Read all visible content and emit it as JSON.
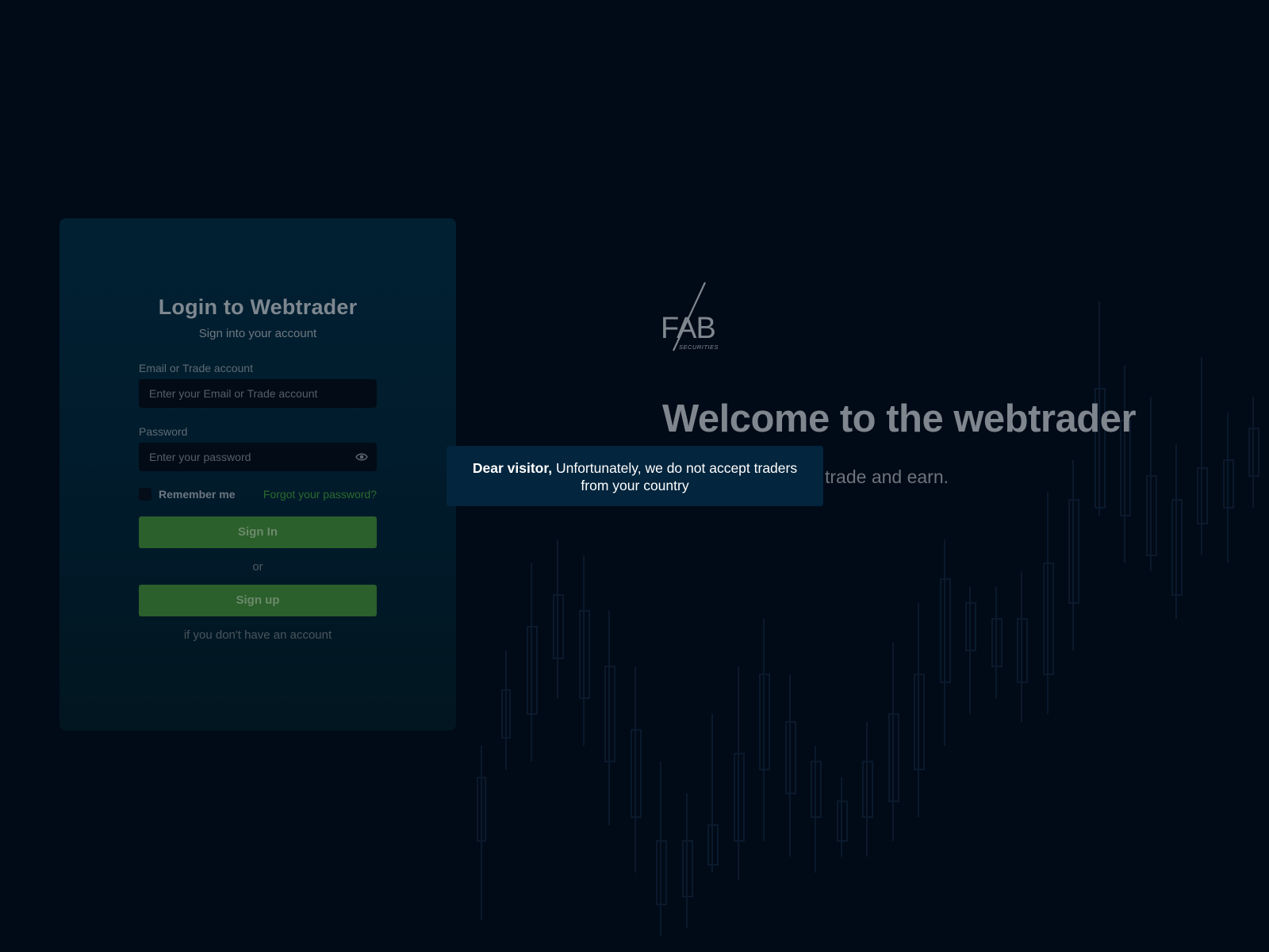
{
  "login": {
    "title": "Login to Webtrader",
    "subtitle": "Sign into your account",
    "email_label": "Email or Trade account",
    "email_placeholder": "Enter your Email or Trade account",
    "password_label": "Password",
    "password_placeholder": "Enter your password",
    "remember_label": "Remember me",
    "forgot_link": "Forgot your password?",
    "signin_button": "Sign In",
    "or_text": "or",
    "signup_button": "Sign up",
    "signup_note": "if you don't have an account"
  },
  "brand": {
    "logo_text": "FAB",
    "logo_sub": "SECURITIES"
  },
  "hero": {
    "welcome": "Welcome to the webtrader",
    "tagline": "trade and earn."
  },
  "toast": {
    "bold": "Dear visitor,",
    "message": " Unfortunately, we do not accept traders",
    "message_line2": "from your country"
  },
  "colors": {
    "background": "#010a17",
    "card": "#012133",
    "button": "#2b5f2c",
    "link": "#2c6a2c",
    "toast": "#03253d"
  },
  "icons": {
    "password_toggle": "eye-icon"
  }
}
